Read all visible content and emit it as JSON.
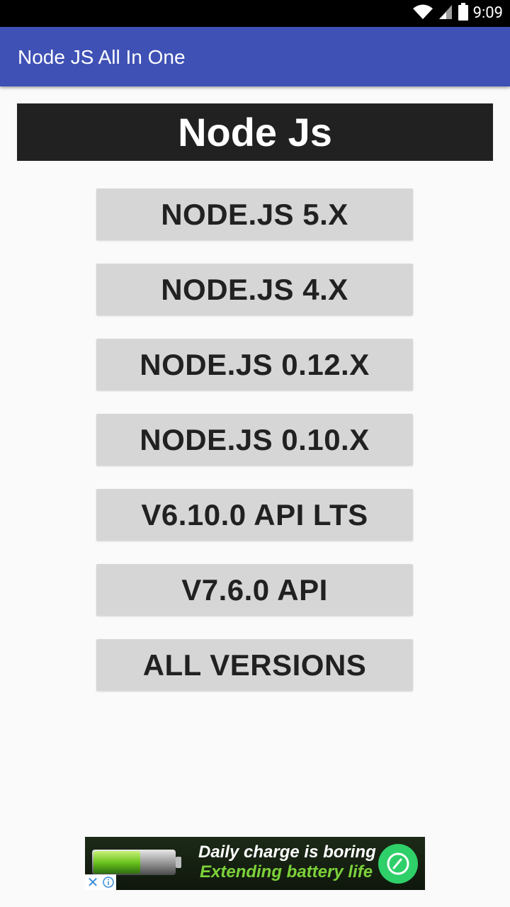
{
  "status_bar": {
    "time": "9:09",
    "icons": [
      "wifi-icon",
      "signal-icon",
      "battery-icon"
    ]
  },
  "app_bar": {
    "title": "Node JS All In One",
    "color": "#3f51b5"
  },
  "header": {
    "text": "Node Js"
  },
  "buttons": [
    {
      "label": "NODE.JS 5.X"
    },
    {
      "label": "NODE.JS 4.X"
    },
    {
      "label": "NODE.JS 0.12.X"
    },
    {
      "label": "NODE.JS 0.10.X"
    },
    {
      "label": "V6.10.0 API LTS"
    },
    {
      "label": "V7.6.0 API"
    },
    {
      "label": "ALL VERSIONS"
    }
  ],
  "ad": {
    "line1": "Daily charge is boring",
    "line2": "Extending battery life",
    "icons": [
      "battery-image",
      "charge-cta-icon",
      "close-icon",
      "info-icon"
    ],
    "accent": "#7cd23a"
  }
}
